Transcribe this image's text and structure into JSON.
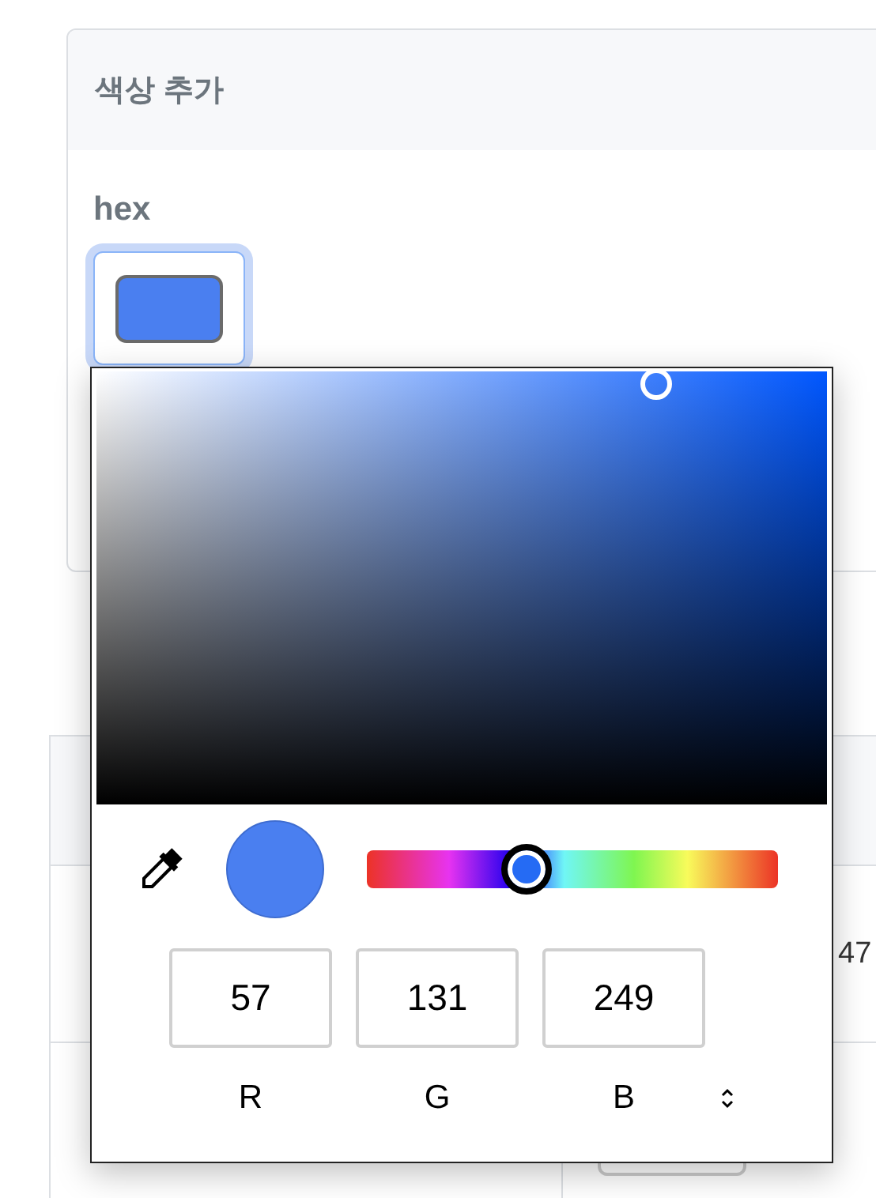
{
  "card": {
    "title": "색상 추가",
    "field_label": "hex",
    "swatch": {
      "color": "#4a7ff0",
      "focused": true
    }
  },
  "table": {
    "cell": "47"
  },
  "color_picker": {
    "hue_slider": {
      "level": 0.39
    },
    "preview": {
      "color": "#4a7ff0"
    },
    "channels": [
      {
        "value": "57",
        "label": "R"
      },
      {
        "value": "131",
        "label": "G"
      },
      {
        "value": "249",
        "label": "B"
      }
    ]
  }
}
